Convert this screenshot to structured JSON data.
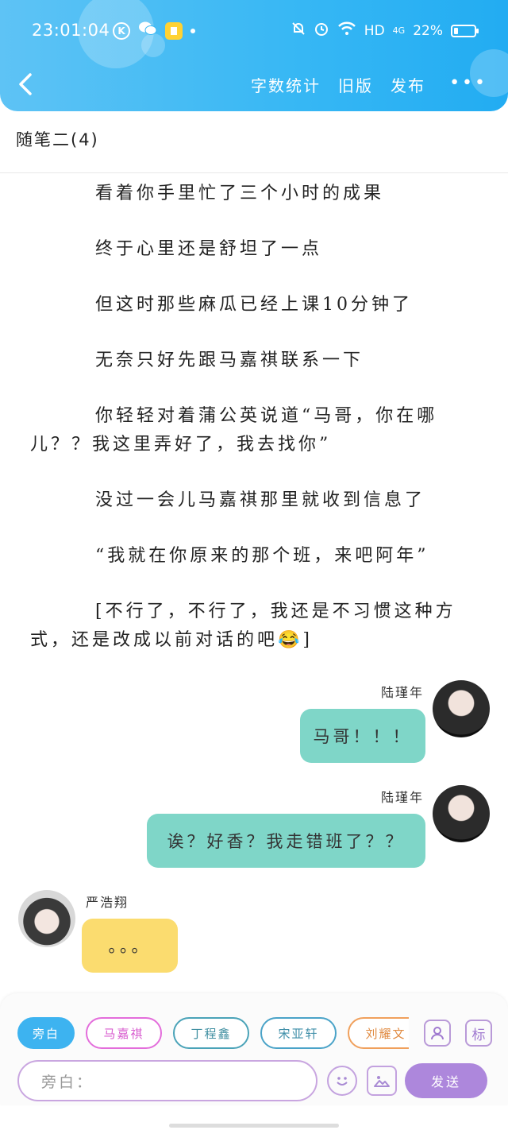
{
  "status_bar": {
    "time": "23:01:04",
    "k_icon": "K",
    "network": "HD",
    "signal": "4G",
    "battery_text": "22%",
    "battery_level": 0.22
  },
  "nav": {
    "back_icon": "chevron-left-icon",
    "actions": [
      "字数统计",
      "旧版",
      "发布"
    ],
    "more": "•••"
  },
  "chapter": {
    "title": "随笔二(4)"
  },
  "paragraphs": [
    "看着你手里忙了三个小时的成果",
    "终于心里还是舒坦了一点",
    "但这时那些麻瓜已经上课10分钟了",
    "无奈只好先跟马嘉祺联系一下",
    "你轻轻对着蒲公英说道“马哥，你在哪儿？？我这里弄好了，我去找你”",
    "没过一会儿马嘉祺那里就收到信息了",
    "“我就在你原来的那个班，来吧阿年”",
    "[不行了，不行了，我还是不习惯这种方式，还是改成以前对话的吧😂]"
  ],
  "messages": [
    {
      "sender": "陆瑾年",
      "text": "马哥！！！",
      "side": "right"
    },
    {
      "sender": "陆瑾年",
      "text": "诶？好香？我走错班了？？",
      "side": "right"
    },
    {
      "sender": "严浩翔",
      "text": "。。。",
      "side": "left"
    }
  ],
  "composer": {
    "roles": [
      {
        "label": "旁白",
        "color": "#3db3f0"
      },
      {
        "label": "马嘉祺",
        "color": "#e36ddb"
      },
      {
        "label": "丁程鑫",
        "color": "#4aa3b8"
      },
      {
        "label": "宋亚轩",
        "color": "#4aa3c8"
      },
      {
        "label": "刘耀文",
        "color": "#f0a05c"
      }
    ],
    "role_icon": "person-card-icon",
    "tag_label": "标",
    "placeholder": "旁白：",
    "emoji_icon": "smiley-icon",
    "image_icon": "image-icon",
    "send_label": "发送"
  }
}
